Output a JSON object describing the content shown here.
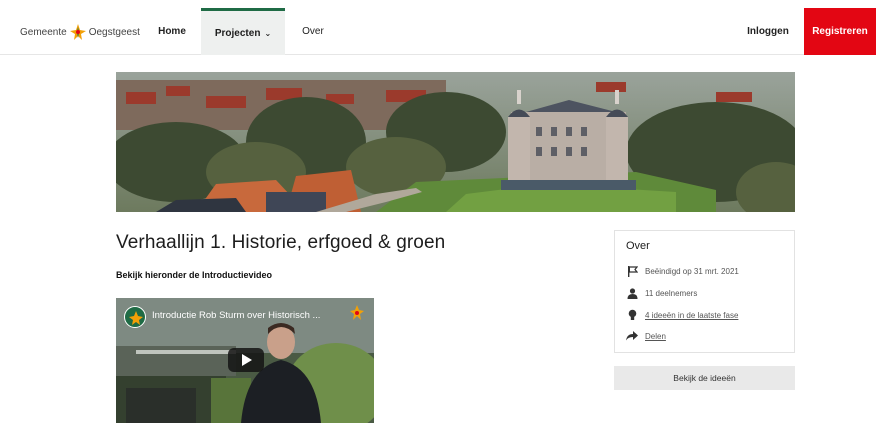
{
  "nav": {
    "logo_left": "Gemeente",
    "logo_right": "Oegstgeest",
    "home": "Home",
    "projecten": "Projecten",
    "over": "Over",
    "login": "Inloggen",
    "register": "Registreren",
    "accent_color": "#1f6b45",
    "register_color": "#e30613"
  },
  "page": {
    "title": "Verhaallijn 1. Historie, erfgoed & groen",
    "subtitle": "Bekijk hieronder de Introductievideo"
  },
  "video": {
    "title": "Introductie Rob Sturm over Historisch ..."
  },
  "about": {
    "heading": "Over",
    "ended": "Beëindigd op 31 mrt. 2021",
    "participants": "11 deelnemers",
    "ideas_link": "4 ideeën in de laatste fase",
    "share": "Delen",
    "button": "Bekijk de ideeën"
  }
}
